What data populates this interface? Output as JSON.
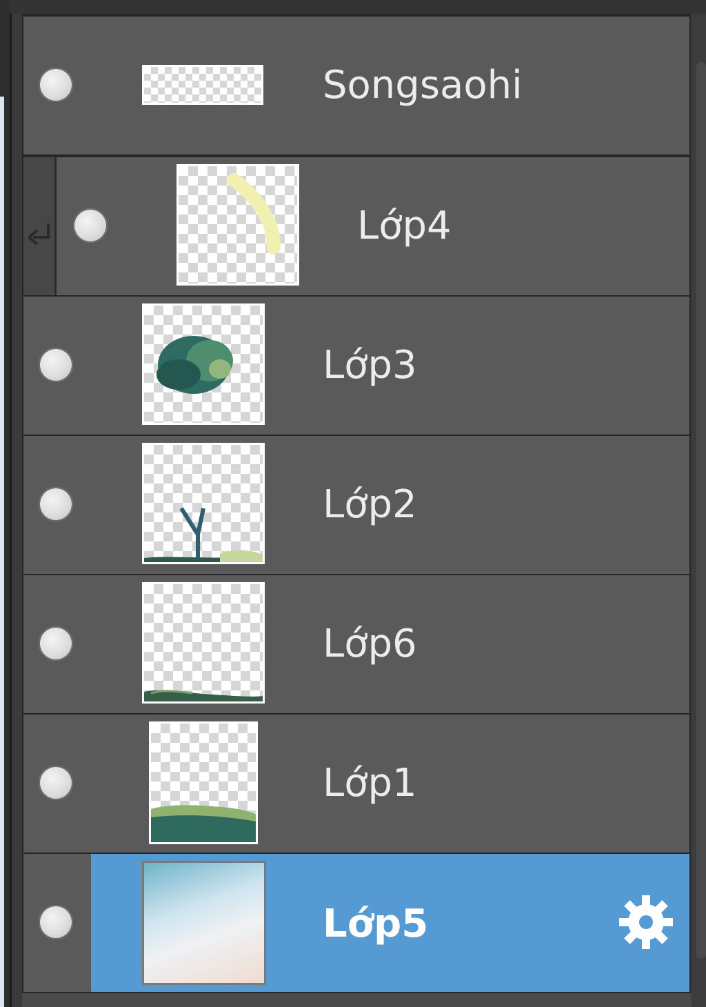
{
  "layers": [
    {
      "name": "Songsaohi",
      "clipped": false,
      "selected": false,
      "visible": true,
      "thumbnail": "text-strip"
    },
    {
      "name": "Lớp4",
      "clipped": true,
      "selected": false,
      "visible": true,
      "thumbnail": "yellow-stroke"
    },
    {
      "name": "Lớp3",
      "clipped": false,
      "selected": false,
      "visible": true,
      "thumbnail": "tree-canopy"
    },
    {
      "name": "Lớp2",
      "clipped": false,
      "selected": false,
      "visible": true,
      "thumbnail": "trunk"
    },
    {
      "name": "Lớp6",
      "clipped": false,
      "selected": false,
      "visible": true,
      "thumbnail": "grass-line"
    },
    {
      "name": "Lớp1",
      "clipped": false,
      "selected": false,
      "visible": true,
      "thumbnail": "hill"
    },
    {
      "name": "Lớp5",
      "clipped": false,
      "selected": true,
      "visible": true,
      "thumbnail": "sky-gradient"
    }
  ],
  "icons": {
    "visibility": "visibility-dot-icon",
    "clipping": "clip-arrow-icon",
    "settings": "gear-icon"
  },
  "colors": {
    "selected": "#559ad2",
    "row": "#5a5a5a",
    "text": "#ececec"
  }
}
